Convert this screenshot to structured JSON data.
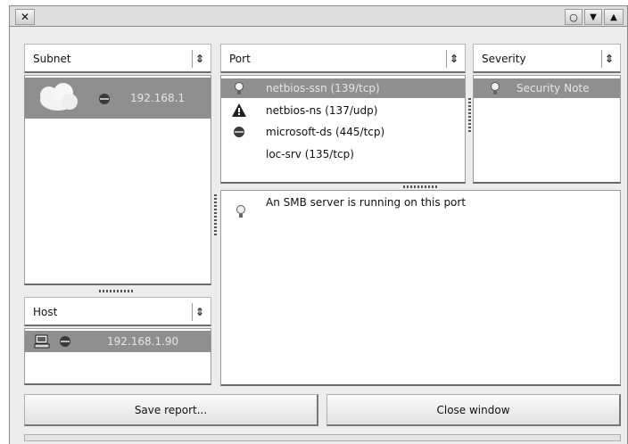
{
  "window": {
    "close_glyph": "✕",
    "restore_glyph": "○",
    "menu_glyph": "▼",
    "shade_glyph": "▲"
  },
  "subnet": {
    "label": "Subnet",
    "spin_glyph": "⇕",
    "items": [
      {
        "text": "192.168.1",
        "icon": "cloud-icon",
        "status": "info-icon",
        "selected": true
      }
    ]
  },
  "host": {
    "label": "Host",
    "spin_glyph": "⇕",
    "items": [
      {
        "text": "192.168.1.90",
        "icon": "computer-icon",
        "status": "info-icon",
        "selected": true
      }
    ]
  },
  "port": {
    "label": "Port",
    "spin_glyph": "⇕",
    "items": [
      {
        "text": "netbios-ssn (139/tcp)",
        "icon": "bulb-icon",
        "selected": true
      },
      {
        "text": "netbios-ns (137/udp)",
        "icon": "warning-icon",
        "selected": false
      },
      {
        "text": "microsoft-ds (445/tcp)",
        "icon": "info-icon",
        "selected": false
      },
      {
        "text": "loc-srv (135/tcp)",
        "icon": "",
        "selected": false
      }
    ]
  },
  "severity": {
    "label": "Severity",
    "spin_glyph": "⇕",
    "items": [
      {
        "text": "Security Note",
        "icon": "bulb-icon",
        "selected": true
      }
    ]
  },
  "details": {
    "text": "An SMB server is running on this port",
    "icon": "bulb-icon"
  },
  "buttons": {
    "save": "Save report...",
    "close": "Close window"
  },
  "colors": {
    "selection": "#8f8f8f",
    "window_bg": "#ececec"
  }
}
